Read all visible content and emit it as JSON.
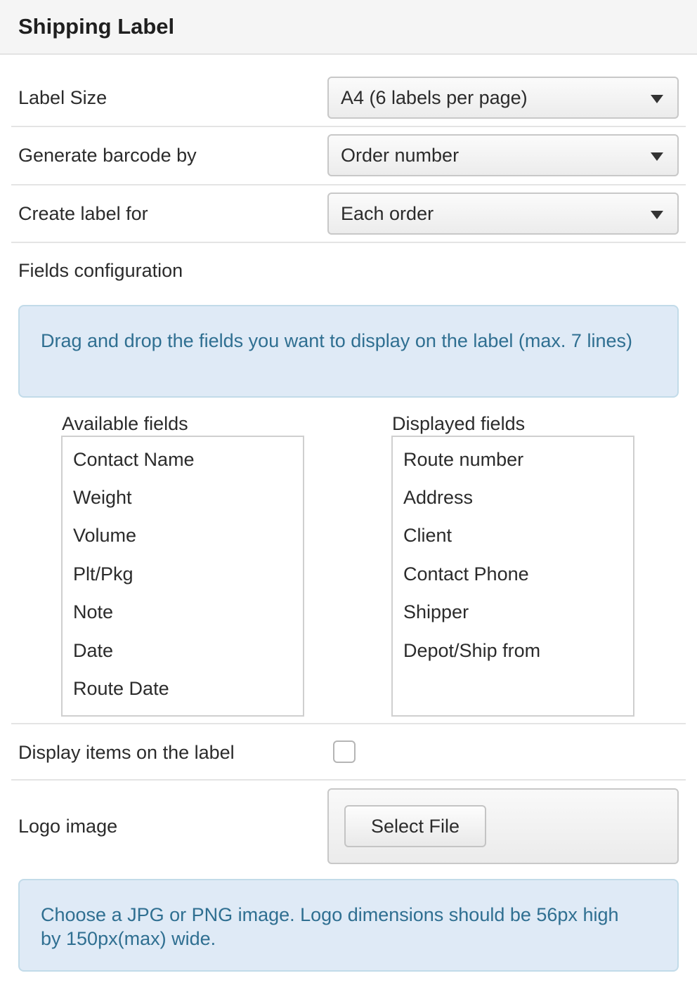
{
  "header": {
    "title": "Shipping Label"
  },
  "form": {
    "label_size": {
      "label": "Label Size",
      "value": "A4 (6 labels per page)"
    },
    "barcode": {
      "label": "Generate barcode by",
      "value": "Order number"
    },
    "create_for": {
      "label": "Create label for",
      "value": "Each order"
    },
    "fields_config": {
      "label": "Fields configuration",
      "info": "Drag and drop the fields you want to display on the label (max. 7 lines)",
      "available": {
        "title": "Available fields",
        "items": [
          "Contact Name",
          "Weight",
          "Volume",
          "Plt/Pkg",
          "Note",
          "Date",
          "Route Date"
        ]
      },
      "displayed": {
        "title": "Displayed fields",
        "items": [
          "Route number",
          "Address",
          "Client",
          "Contact Phone",
          "Shipper",
          "Depot/Ship from"
        ]
      }
    },
    "display_items": {
      "label": "Display items on the label",
      "checked": false
    },
    "logo": {
      "label": "Logo image",
      "button_label": "Select File",
      "info": "Choose a JPG or PNG image. Logo dimensions should be 56px high by 150px(max) wide."
    }
  }
}
